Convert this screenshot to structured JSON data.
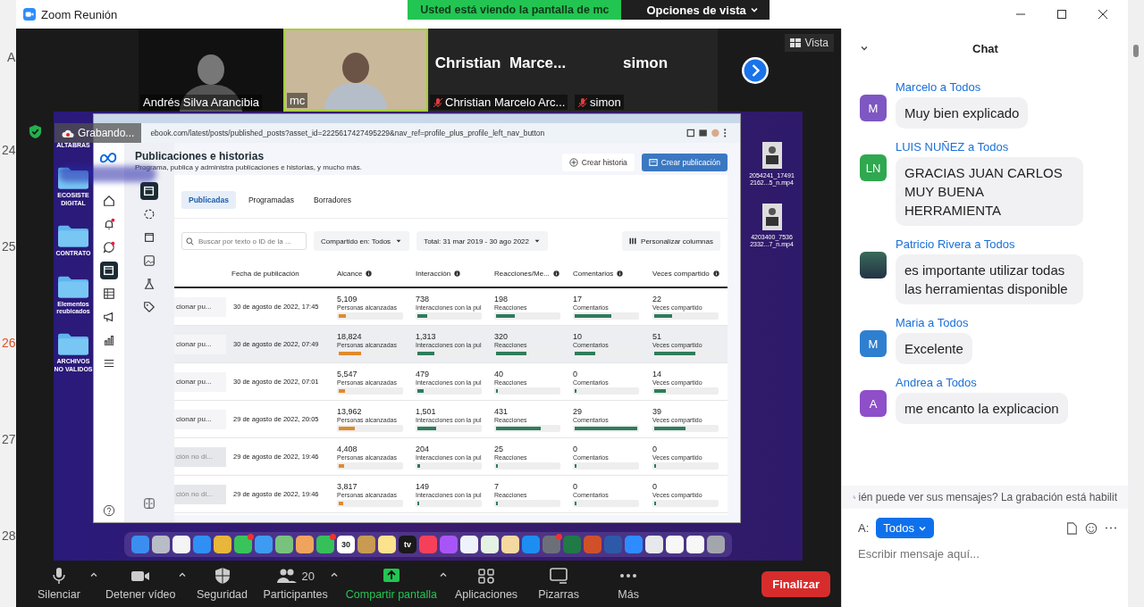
{
  "window": {
    "title": "Zoom Reunión",
    "banner": "Usted está viendo la pantalla de mc",
    "view_options": "Opciones de vista"
  },
  "background_app": {
    "letter": "A",
    "days": [
      {
        "label": "24",
        "highlight": false
      },
      {
        "label": "25",
        "highlight": false
      },
      {
        "label": "26",
        "highlight": true
      },
      {
        "label": "27",
        "highlight": false
      },
      {
        "label": "28",
        "highlight": false
      }
    ]
  },
  "participants": [
    {
      "name": "Andrés Silva Arancibia",
      "kind": "video",
      "muted": false,
      "active": false
    },
    {
      "name": "mc",
      "kind": "video",
      "muted": false,
      "active": true
    },
    {
      "name": "Christian Marcelo Arc...",
      "display": "Christian  Marce...",
      "kind": "name",
      "muted": true,
      "active": false
    },
    {
      "name": "simon",
      "display": "simon",
      "kind": "name",
      "muted": true,
      "active": false
    }
  ],
  "view_button": "Vista",
  "shared_screen": {
    "recording": "Grabando...",
    "desktop_items": [
      {
        "label": "ALTABRAS",
        "kind": "label"
      },
      {
        "label": "ECOSISTE DIGITAL",
        "kind": "folder"
      },
      {
        "label": "CONTRATO",
        "kind": "folder"
      },
      {
        "label": "Elementos reubicados",
        "kind": "folder"
      },
      {
        "label": "ARCHIVOS NO VALIDOS",
        "kind": "folder"
      }
    ],
    "desktop_files": [
      {
        "label": "2054241_17491 2162...5_n.mp4"
      },
      {
        "label": "4203400_7536 2332...7_n.mp4"
      }
    ],
    "browser": {
      "url": "ebook.com/latest/posts/published_posts?asset_id=2225617427495229&nav_ref=profile_plus_profile_left_nav_button",
      "nav": [
        {
          "kind": "home",
          "selected": false,
          "badge": false
        },
        {
          "kind": "bell",
          "selected": false,
          "badge": true
        },
        {
          "kind": "bubble",
          "selected": false,
          "badge": true
        },
        {
          "kind": "posts",
          "selected": true,
          "badge": false
        },
        {
          "kind": "table",
          "selected": false,
          "badge": false
        },
        {
          "kind": "megaphone",
          "selected": false,
          "badge": false
        },
        {
          "kind": "chart",
          "selected": false,
          "badge": false
        },
        {
          "kind": "menu",
          "selected": false,
          "badge": false
        }
      ],
      "subnav": [
        {
          "kind": "posts",
          "selected": true
        },
        {
          "kind": "spinner",
          "selected": false
        },
        {
          "kind": "frame",
          "selected": false
        },
        {
          "kind": "image",
          "selected": false
        },
        {
          "kind": "flask",
          "selected": false
        },
        {
          "kind": "tag",
          "selected": false
        }
      ],
      "title": "Publicaciones e historias",
      "subtitle": "Programa, publica y administra publicaciones e historias, y mucho más.",
      "actions": [
        {
          "label": "Crear historia",
          "primary": false
        },
        {
          "label": "Crear publicación",
          "primary": true
        }
      ],
      "tabs": [
        {
          "label": "Publicadas",
          "selected": true
        },
        {
          "label": "Programadas",
          "selected": false
        },
        {
          "label": "Borradores",
          "selected": false
        }
      ],
      "search": {
        "placeholder": "Buscar por texto o ID de la ..."
      },
      "filters": [
        "Compartido en: Todos",
        "Total: 31 mar 2019 - 30 ago 2022"
      ],
      "customize": "Personalizar columnas",
      "columns": [
        {
          "label": "Fecha de publicación",
          "kind": "date"
        },
        {
          "label": "Alcance",
          "kind": "metric",
          "color": "#e08a2c"
        },
        {
          "label": "Interacción",
          "kind": "metric",
          "color": "#2e7d5b"
        },
        {
          "label": "Reacciones/Me...",
          "kind": "metric",
          "color": "#2e7d5b"
        },
        {
          "label": "Comentarios",
          "kind": "metric",
          "color": "#2e7d5b"
        },
        {
          "label": "Veces compartido",
          "kind": "metric",
          "color": "#2e7d5b"
        }
      ],
      "rows": [
        {
          "action": "cionar pu...",
          "disabled": false,
          "hovered": false,
          "date": "30 de agosto de 2022, 17:45",
          "metrics": [
            {
              "value": "5,109",
              "label": "Personas alcanzadas",
              "level": 0.12
            },
            {
              "value": "738",
              "label": "Interacciones con la pul",
              "level": 0.15
            },
            {
              "value": "198",
              "label": "Reacciones",
              "level": 0.3
            },
            {
              "value": "17",
              "label": "Comentarios",
              "level": 0.58
            },
            {
              "value": "22",
              "label": "Veces compartido",
              "level": 0.28
            }
          ]
        },
        {
          "action": "cionar pu...",
          "disabled": false,
          "hovered": true,
          "date": "30 de agosto de 2022, 07:49",
          "metrics": [
            {
              "value": "18,824",
              "label": "Personas alcanzadas",
              "level": 0.35
            },
            {
              "value": "1,313",
              "label": "Interacciones con la pul",
              "level": 0.27
            },
            {
              "value": "320",
              "label": "Reacciones",
              "level": 0.48
            },
            {
              "value": "10",
              "label": "Comentarios",
              "level": 0.33
            },
            {
              "value": "51",
              "label": "Veces compartido",
              "level": 0.66
            }
          ]
        },
        {
          "action": "cionar pu...",
          "disabled": false,
          "hovered": false,
          "date": "30 de agosto de 2022, 07:01",
          "metrics": [
            {
              "value": "5,547",
              "label": "Personas alcanzadas",
              "level": 0.1
            },
            {
              "value": "479",
              "label": "Interacciones con la pul",
              "level": 0.1
            },
            {
              "value": "40",
              "label": "Reacciones",
              "level": 0.03
            },
            {
              "value": "0",
              "label": "Comentarios",
              "level": 0
            },
            {
              "value": "14",
              "label": "Veces compartido",
              "level": 0.18
            }
          ]
        },
        {
          "action": "cionar pu...",
          "disabled": false,
          "hovered": false,
          "date": "29 de agosto de 2022, 20:05",
          "metrics": [
            {
              "value": "13,962",
              "label": "Personas alcanzadas",
              "level": 0.25
            },
            {
              "value": "1,501",
              "label": "Interacciones con la pul",
              "level": 0.3
            },
            {
              "value": "431",
              "label": "Reacciones",
              "level": 0.72
            },
            {
              "value": "29",
              "label": "Comentarios",
              "level": 1
            },
            {
              "value": "39",
              "label": "Veces compartido",
              "level": 0.5
            }
          ]
        },
        {
          "action": "ción no di...",
          "disabled": true,
          "hovered": false,
          "date": "29 de agosto de 2022, 19:46",
          "metrics": [
            {
              "value": "4,408",
              "label": "Personas alcanzadas",
              "level": 0.08
            },
            {
              "value": "204",
              "label": "Interacciones con la pul",
              "level": 0.04
            },
            {
              "value": "25",
              "label": "Reacciones",
              "level": 0.02
            },
            {
              "value": "0",
              "label": "Comentarios",
              "level": 0
            },
            {
              "value": "0",
              "label": "Veces compartido",
              "level": 0
            }
          ]
        },
        {
          "action": "ción no di...",
          "disabled": true,
          "hovered": false,
          "date": "29 de agosto de 2022, 19:46",
          "metrics": [
            {
              "value": "3,817",
              "label": "Personas alcanzadas",
              "level": 0.07
            },
            {
              "value": "149",
              "label": "Interacciones con la pul",
              "level": 0.03
            },
            {
              "value": "7",
              "label": "Reacciones",
              "level": 0.01
            },
            {
              "value": "0",
              "label": "Comentarios",
              "level": 0
            },
            {
              "value": "0",
              "label": "Veces compartido",
              "level": 0
            }
          ]
        }
      ]
    },
    "dock": [
      {
        "color": "#3b8ef0",
        "badge": false
      },
      {
        "color": "#b8bcc6",
        "badge": false
      },
      {
        "color": "#f4f4f4",
        "badge": false
      },
      {
        "color": "#2f8ff5",
        "badge": false
      },
      {
        "color": "#e8b63a",
        "badge": false
      },
      {
        "color": "#38c45a",
        "badge": true
      },
      {
        "color": "#3d9bf2",
        "badge": false
      },
      {
        "color": "#79c27e",
        "badge": false
      },
      {
        "color": "#f0a35c",
        "badge": false
      },
      {
        "color": "#35c05a",
        "badge": true
      },
      {
        "color": "#ffffff",
        "badge": false,
        "label": "30"
      },
      {
        "color": "#c89a52",
        "badge": false
      },
      {
        "color": "#fbe28c",
        "badge": false
      },
      {
        "color": "#1a1a1a",
        "badge": false,
        "label": "tv"
      },
      {
        "color": "#f6405a",
        "badge": false
      },
      {
        "color": "#a855f7",
        "badge": false
      },
      {
        "color": "#eef3fb",
        "badge": false
      },
      {
        "color": "#e4f2e4",
        "badge": false
      },
      {
        "color": "#f3d9a0",
        "badge": false
      },
      {
        "color": "#1c8ef2",
        "badge": false
      },
      {
        "color": "#6b7078",
        "badge": true
      },
      {
        "color": "#1f7a45",
        "badge": false
      },
      {
        "color": "#d0502a",
        "badge": false
      },
      {
        "color": "#2c5aa8",
        "badge": false
      },
      {
        "color": "#2d8cff",
        "badge": false
      },
      {
        "color": "#e6e8ec",
        "badge": false
      },
      {
        "color": "#f7f7f7",
        "badge": false
      },
      {
        "color": "#f7f7f7",
        "badge": false
      },
      {
        "color": "#a3a6ad",
        "badge": false
      }
    ]
  },
  "toolbar": [
    {
      "label": "Silenciar",
      "kind": "mic",
      "caret": true,
      "highlight": false
    },
    {
      "label": "Detener vídeo",
      "kind": "camera",
      "caret": true,
      "highlight": false
    },
    {
      "label": "Seguridad",
      "kind": "shield",
      "caret": false,
      "highlight": false
    },
    {
      "label": "Participantes",
      "kind": "people",
      "count": "20",
      "caret": true,
      "highlight": false
    },
    {
      "label": "Compartir pantalla",
      "kind": "share",
      "caret": true,
      "highlight": true
    },
    {
      "label": "Aplicaciones",
      "kind": "apps",
      "caret": false,
      "highlight": false
    },
    {
      "label": "Pizarras",
      "kind": "whiteboard",
      "caret": false,
      "highlight": false
    },
    {
      "label": "Más",
      "kind": "more",
      "caret": false,
      "highlight": false
    }
  ],
  "end_button": "Finalizar",
  "chat": {
    "title": "Chat",
    "messages": [
      {
        "sender": "Marcelo a Todos",
        "avatar": {
          "kind": "initials",
          "initials": "M",
          "color": "#7e57c2"
        },
        "text": "Muy bien explicado"
      },
      {
        "sender": "LUIS NUÑEZ a Todos",
        "avatar": {
          "kind": "initials",
          "initials": "LN",
          "color": "#2fa84f"
        },
        "text": "GRACIAS JUAN CARLOS MUY BUENA HERRAMIENTA"
      },
      {
        "sender": "Patricio Rivera a Todos",
        "avatar": {
          "kind": "photo"
        },
        "text": "es importante utilizar todas las herramientas disponible"
      },
      {
        "sender": "Maria a Todos",
        "avatar": {
          "kind": "initials",
          "initials": "M",
          "color": "#2f7fd0"
        },
        "text": "Excelente"
      },
      {
        "sender": "Andrea a Todos",
        "avatar": {
          "kind": "initials",
          "initials": "A",
          "color": "#8e4fc9"
        },
        "text": "me encanto la explicacion"
      }
    ],
    "notice": "ién puede ver sus mensajes? La grabación está habilit",
    "recipient_label": "A:",
    "recipient": "Todos",
    "placeholder": "Escribir mensaje aquí..."
  }
}
